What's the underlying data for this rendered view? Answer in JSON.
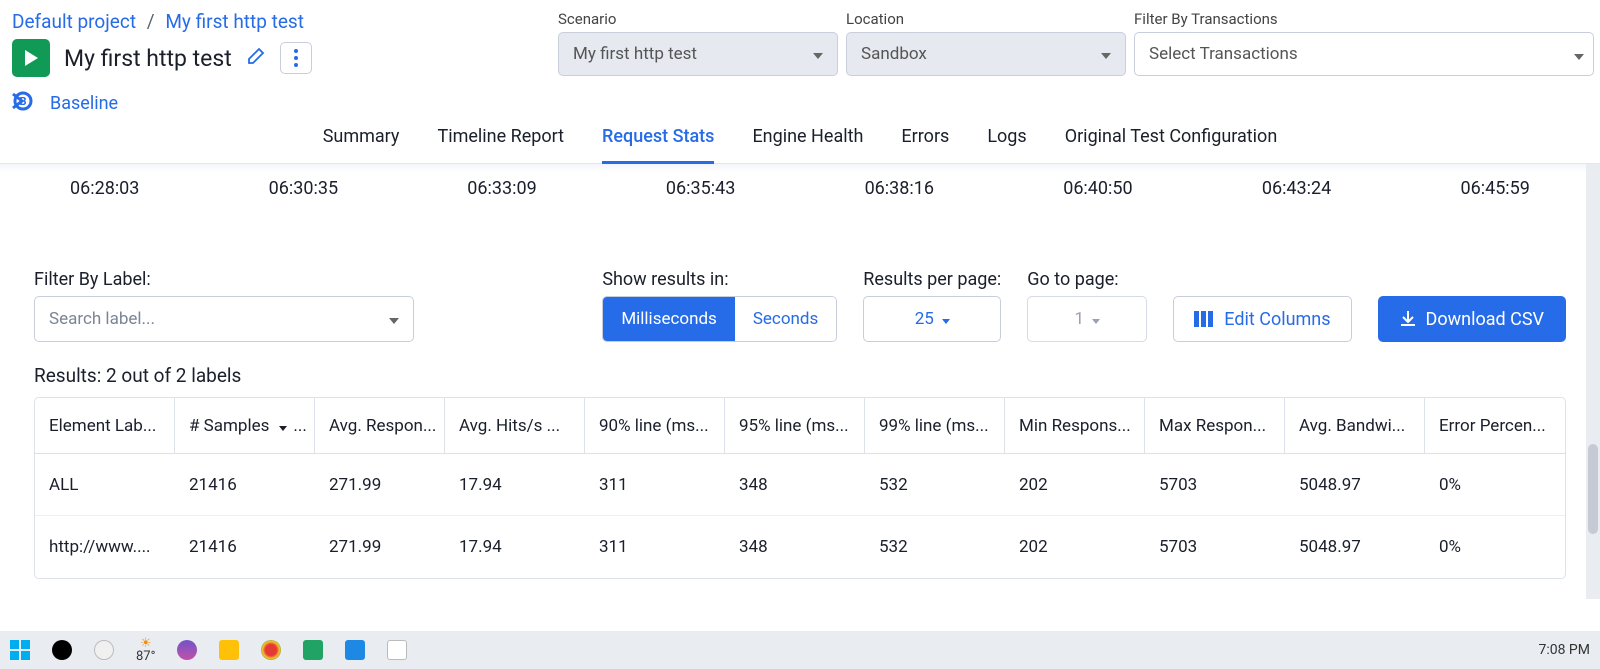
{
  "breadcrumbs": {
    "project": "Default project",
    "test": "My first http test"
  },
  "title": "My first http test",
  "baseline": "Baseline",
  "selectors": {
    "scenario": {
      "label": "Scenario",
      "value": "My first http test"
    },
    "location": {
      "label": "Location",
      "value": "Sandbox"
    },
    "transactions": {
      "label": "Filter By Transactions",
      "value": "Select Transactions"
    }
  },
  "tabs": [
    "Summary",
    "Timeline Report",
    "Request Stats",
    "Engine Health",
    "Errors",
    "Logs",
    "Original Test Configuration"
  ],
  "active_tab": "Request Stats",
  "timeline": [
    "06:28:03",
    "06:30:35",
    "06:33:09",
    "06:35:43",
    "06:38:16",
    "06:40:50",
    "06:43:24",
    "06:45:59"
  ],
  "filter_label": "Filter By Label:",
  "filter_placeholder": "Search label...",
  "show_results_label": "Show results in:",
  "units": {
    "active": "Milliseconds",
    "inactive": "Seconds"
  },
  "per_page": {
    "label": "Results per page:",
    "value": "25"
  },
  "goto": {
    "label": "Go to page:",
    "value": "1"
  },
  "edit_columns": "Edit Columns",
  "download": "Download CSV",
  "results_count": "Results: 2 out of 2 labels",
  "columns": [
    "Element Lab...",
    "# Samples",
    "Avg. Respon...",
    "Avg. Hits/s ...",
    "90% line (ms...",
    "95% line (ms...",
    "99% line (ms...",
    "Min Respons...",
    "Max Respon...",
    "Avg. Bandwi...",
    "Error Percen..."
  ],
  "sort_col": "# Samples",
  "rows": [
    {
      "label": "ALL",
      "samples": "21416",
      "avg_resp": "271.99",
      "hits": "17.94",
      "p90": "311",
      "p95": "348",
      "p99": "532",
      "min": "202",
      "max": "5703",
      "bw": "5048.97",
      "err": "0%"
    },
    {
      "label": "http://www....",
      "samples": "21416",
      "avg_resp": "271.99",
      "hits": "17.94",
      "p90": "311",
      "p95": "348",
      "p99": "532",
      "min": "202",
      "max": "5703",
      "bw": "5048.97",
      "err": "0%"
    }
  ],
  "taskbar": {
    "weather": "87°",
    "time": "7:08 PM"
  }
}
